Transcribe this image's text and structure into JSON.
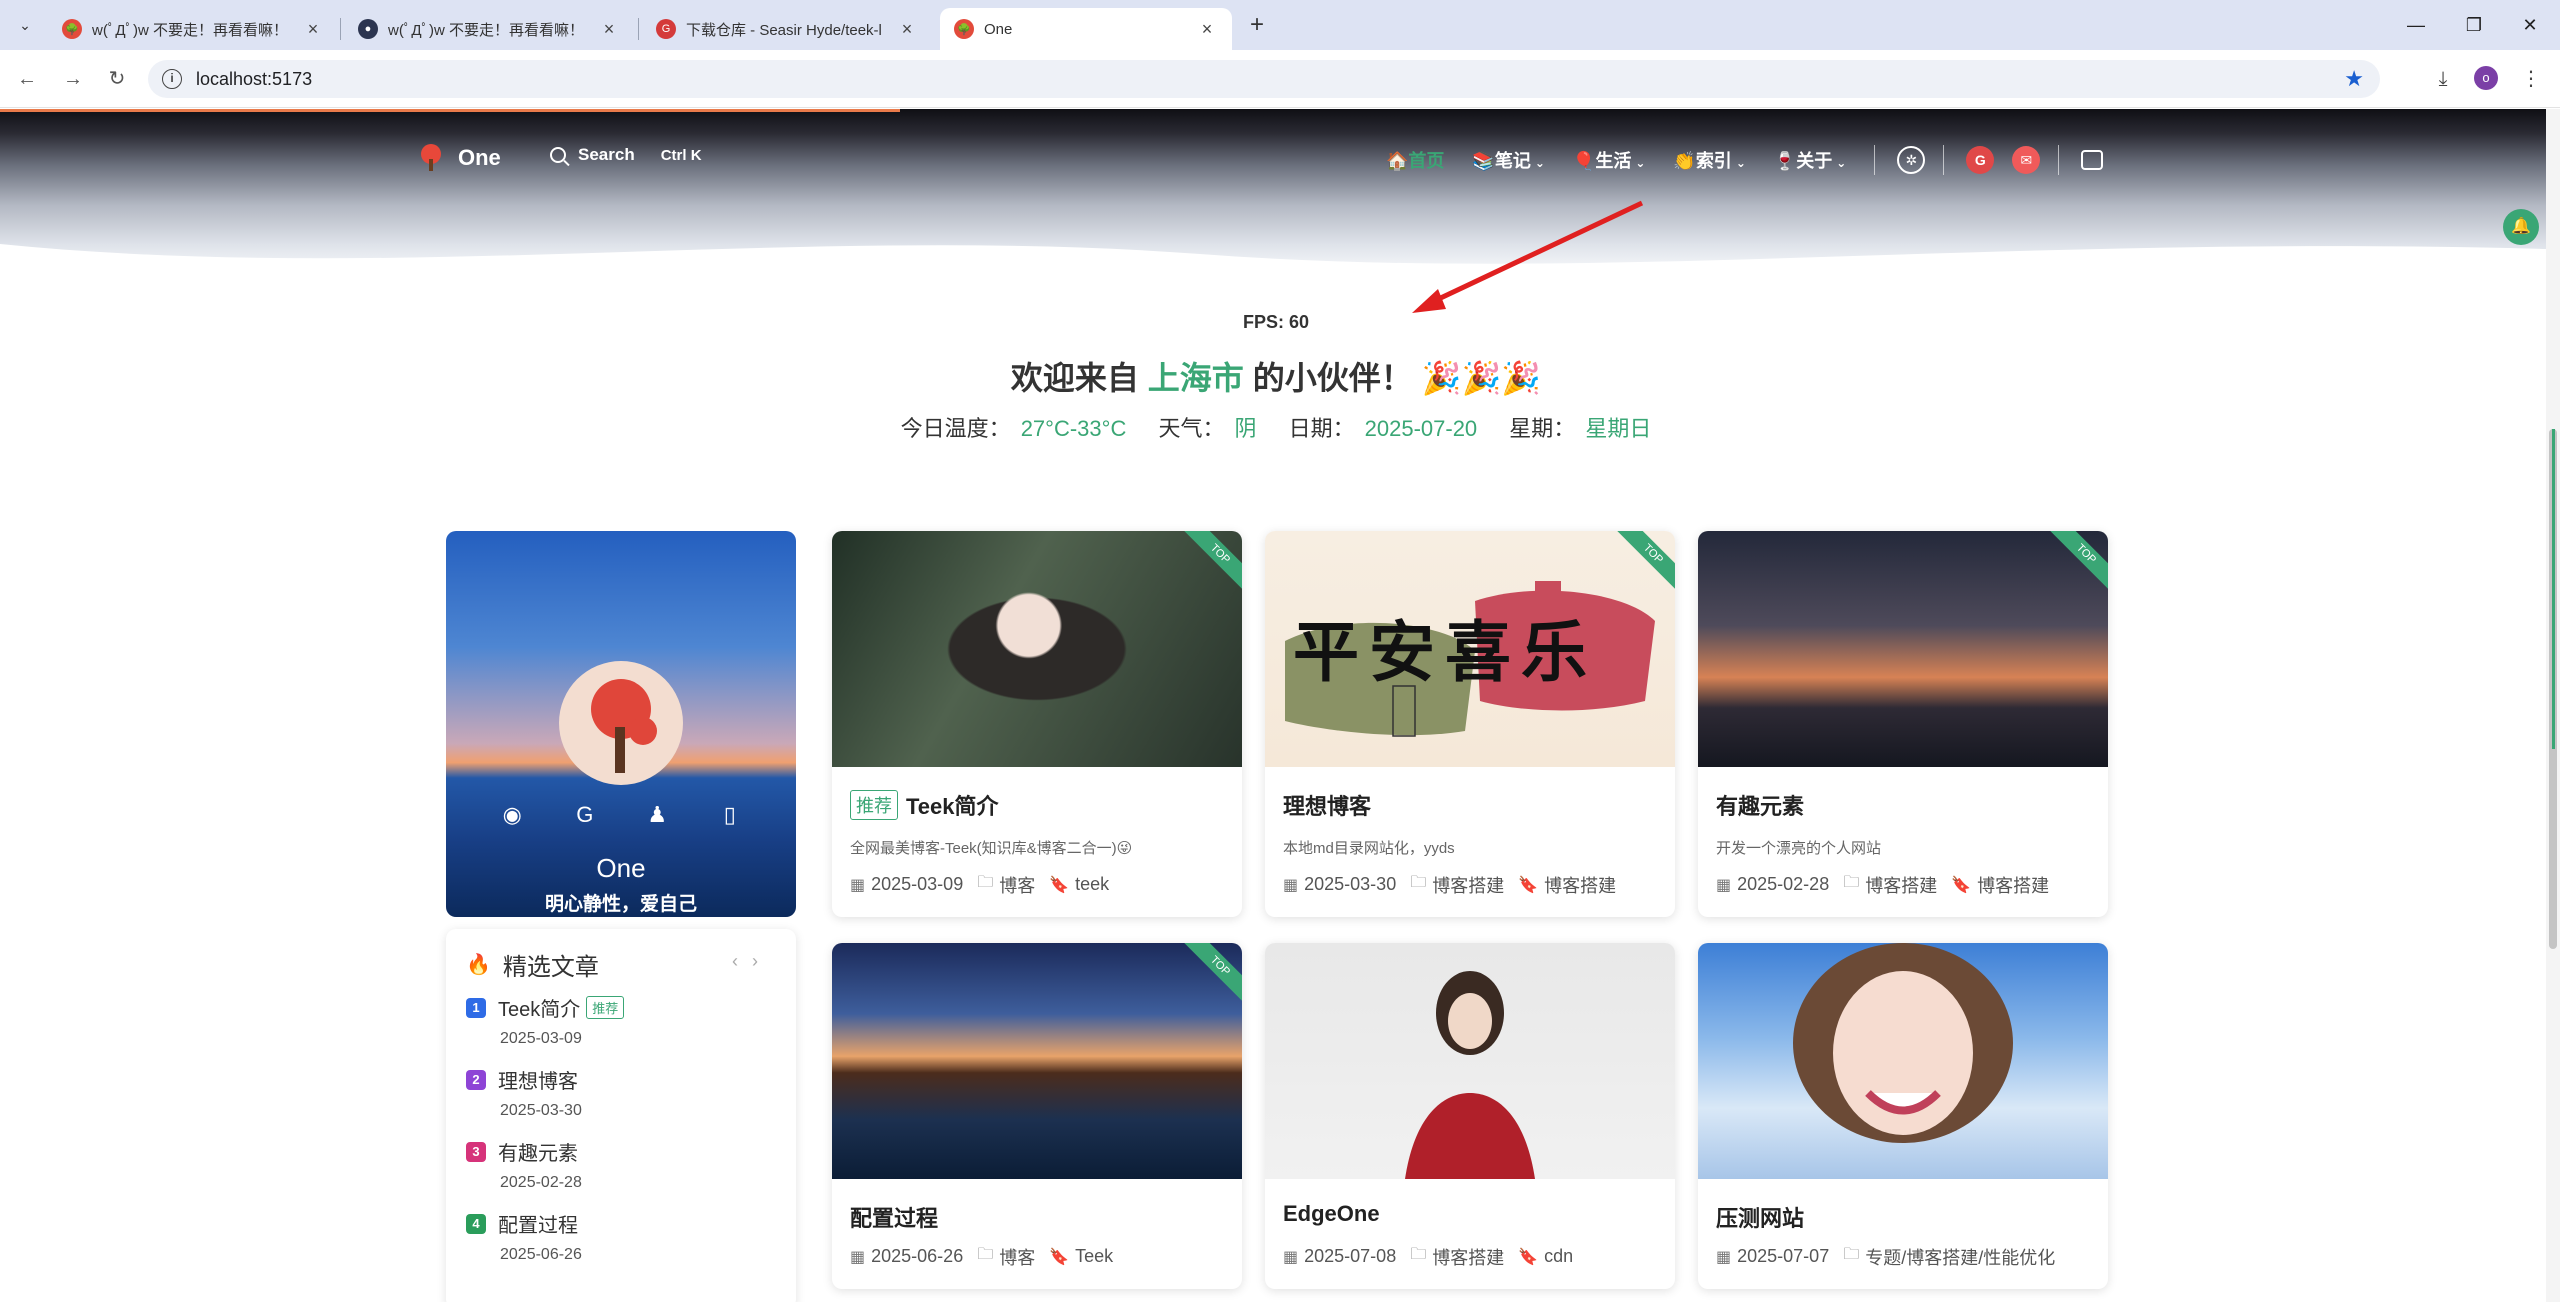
{
  "browser": {
    "tabs": [
      {
        "title": "w(ﾟДﾟ)w 不要走！再看看嘛！"
      },
      {
        "title": "w(ﾟДﾟ)w 不要走！再看看嘛！"
      },
      {
        "title": "下载仓库 - Seasir Hyde/teek-l"
      },
      {
        "title": "One"
      }
    ],
    "url": "localhost:5173",
    "profile_initial": "o"
  },
  "nav": {
    "brand": "One",
    "search_label": "Search",
    "search_shortcut": "Ctrl K",
    "items": [
      {
        "label": "首页"
      },
      {
        "label": "笔记"
      },
      {
        "label": "生活"
      },
      {
        "label": "索引"
      },
      {
        "label": "关于"
      }
    ]
  },
  "fps": "FPS: 60",
  "welcome": {
    "prefix": "欢迎来自",
    "city": "上海市",
    "suffix": "的小伙伴！",
    "emoji": "🎉🎉🎉"
  },
  "weather": {
    "temp_label": "今日温度：",
    "temp": "27°C-33°C",
    "cond_label": "天气：",
    "cond": "阴",
    "date_label": "日期：",
    "date": "2025-07-20",
    "week_label": "星期：",
    "week": "星期日"
  },
  "profile": {
    "name": "One",
    "motto": "明心静性，爱自己"
  },
  "featured": {
    "title": "精选文章",
    "items": [
      {
        "num": "1",
        "title": "Teek简介",
        "badge": "推荐",
        "date": "2025-03-09",
        "color": "#2e6be6"
      },
      {
        "num": "2",
        "title": "理想博客",
        "date": "2025-03-30",
        "color": "#8e44d6"
      },
      {
        "num": "3",
        "title": "有趣元素",
        "date": "2025-02-28",
        "color": "#d6337a"
      },
      {
        "num": "4",
        "title": "配置过程",
        "date": "2025-06-26",
        "color": "#2a9d5b"
      }
    ]
  },
  "cards": [
    {
      "tag": "推荐",
      "title": "Teek简介",
      "desc": "全网最美博客-Teek(知识库&博客二合一)😜",
      "date": "2025-03-09",
      "category": "博客",
      "tags": "teek",
      "top": true
    },
    {
      "title": "理想博客",
      "desc": "本地md目录网站化，yyds",
      "date": "2025-03-30",
      "category": "博客搭建",
      "tags": "博客搭建",
      "top": true,
      "image_text": "平安喜乐"
    },
    {
      "title": "有趣元素",
      "desc": "开发一个漂亮的个人网站",
      "date": "2025-02-28",
      "category": "博客搭建",
      "tags": "博客搭建",
      "top": true
    },
    {
      "title": "配置过程",
      "date": "2025-06-26",
      "category": "博客",
      "tags": "Teek",
      "top": true
    },
    {
      "title": "EdgeOne",
      "date": "2025-07-08",
      "category": "博客搭建",
      "tags": "cdn",
      "top": false
    },
    {
      "title": "压测网站",
      "date": "2025-07-07",
      "category": "专题/博客搭建/性能优化",
      "top": false
    }
  ],
  "top_ribbon": "TOP"
}
